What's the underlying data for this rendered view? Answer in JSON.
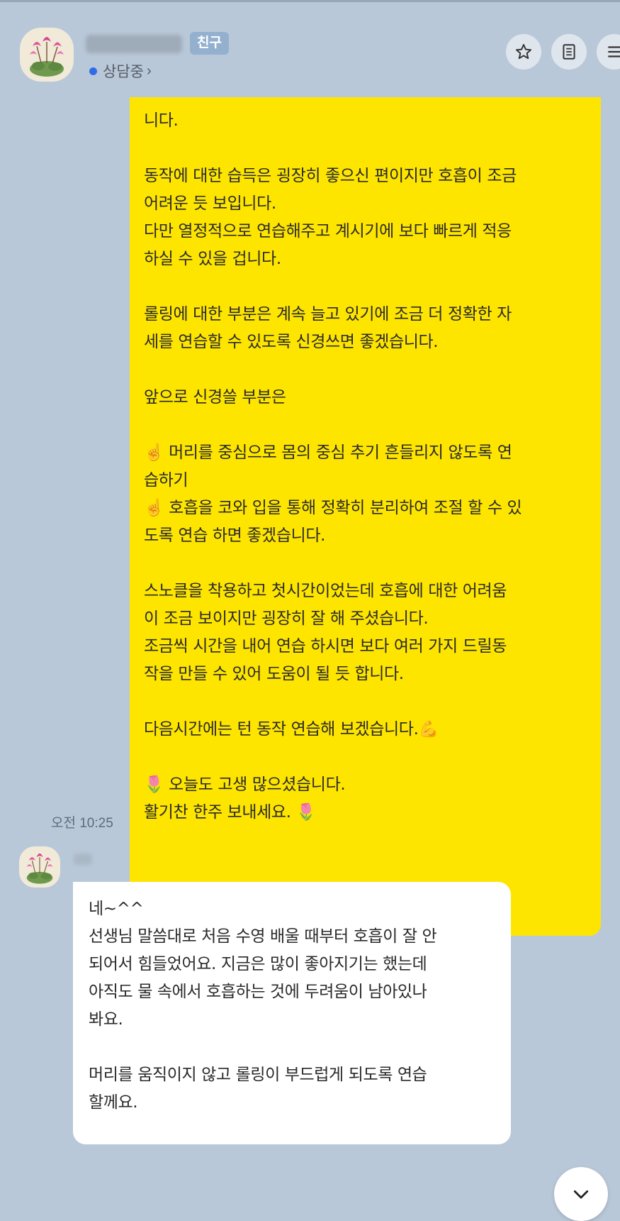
{
  "header": {
    "friend_badge": "친구",
    "status": "상담중",
    "icons": [
      "star-icon",
      "document-icon",
      "menu-icon"
    ]
  },
  "messages": [
    {
      "sender": "me",
      "bubble_color": "#fee500",
      "time": "오전 10:25",
      "text": "니다.\n\n동작에 대한 습득은 굉장히 좋으신 편이지만 호흡이 조금\n어려운 듯 보입니다.\n다만 열정적으로 연습해주고 계시기에 보다 빠르게 적응\n하실 수 있을 겁니다.\n\n롤링에 대한 부분은 계속 늘고 있기에 조금 더 정확한 자\n세를 연습할 수 있도록 신경쓰면 좋겠습니다.\n\n앞으로 신경쓸 부분은\n\n☝️ 머리를 중심으로 몸의 중심 추기 흔들리지 않도록 연\n습하기\n☝️ 호흡을 코와 입을 통해 정확히 분리하여 조절 할 수 있\n도록 연습 하면 좋겠습니다.\n\n스노클을 착용하고 첫시간이었는데 호흡에 대한 어려움\n이 조금 보이지만 굉장히 잘 해 주셨습니다.\n조금씩 시간을 내어 연습 하시면 보다 여러 가지 드릴동\n작을 만들 수 있어 도움이 될 듯 합니다.\n\n다음시간에는 턴 동작 연습해 보겠습니다.💪\n\n🌷 오늘도 고생 많으셨습니다.\n활기찬 한주 보내세요. 🌷"
    },
    {
      "sender": "other",
      "bubble_color": "#ffffff",
      "text": "네~^^\n선생님 말씀대로 처음 수영 배울 때부터 호흡이 잘 안\n되어서 힘들었어요. 지금은 많이 좋아지기는 했는데\n아직도 물 속에서 호흡하는 것에 두려움이 남아있나\n봐요.\n\n머리를 움직이지 않고 롤링이 부드럽게 되도록 연습\n할께요."
    }
  ],
  "scroll_button_icon": "chevron-down-icon"
}
